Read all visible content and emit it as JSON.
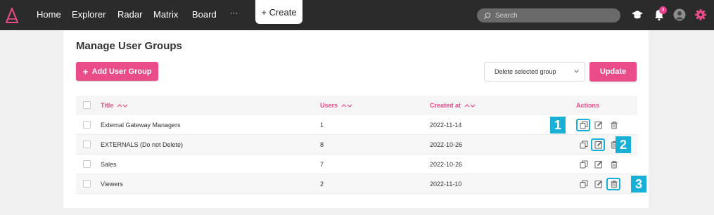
{
  "nav": {
    "items": [
      "Home",
      "Explorer",
      "Radar",
      "Matrix",
      "Board",
      "···"
    ],
    "create_label": "+ Create",
    "search_placeholder": "Search",
    "notification_count": "3"
  },
  "page": {
    "title": "Manage User Groups",
    "add_button": "Add User Group",
    "bulk_action": "Delete selected group",
    "update_button": "Update"
  },
  "table": {
    "columns": [
      "Title",
      "Users",
      "Created at",
      "Actions"
    ],
    "rows": [
      {
        "title": "External Gateway Managers",
        "users": "1",
        "created": "2022-11-14"
      },
      {
        "title": "EXTERNALS (Do not Delete)",
        "users": "8",
        "created": "2022-10-26"
      },
      {
        "title": "Sales",
        "users": "7",
        "created": "2022-10-26"
      },
      {
        "title": "Viewers",
        "users": "2",
        "created": "2022-11-10"
      }
    ]
  },
  "callouts": [
    "1",
    "2",
    "3"
  ],
  "colors": {
    "accent": "#ea4c89",
    "topbar": "#2b2b2b",
    "highlight": "#19b0d8"
  }
}
